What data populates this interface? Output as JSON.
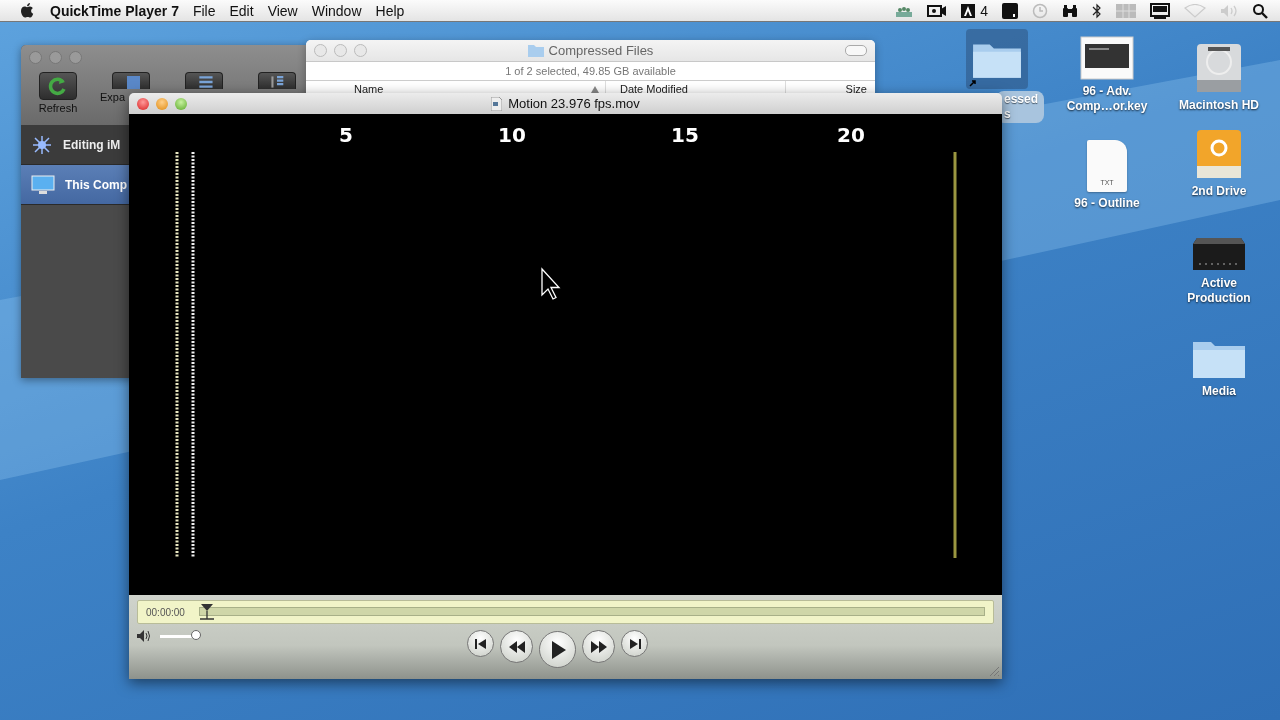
{
  "menubar": {
    "app_name": "QuickTime Player 7",
    "menus": [
      "File",
      "Edit",
      "View",
      "Window",
      "Help"
    ],
    "adobe_updates": "4"
  },
  "back_window": {
    "toolbar": [
      {
        "kind": "refresh",
        "label": "Refresh"
      },
      {
        "kind": "expand",
        "label": "Expa"
      },
      {
        "kind": "list"
      },
      {
        "kind": "detail"
      }
    ],
    "sidebar": [
      {
        "kind": "cluster",
        "label": "Editing iM",
        "selected": false
      },
      {
        "kind": "computer",
        "label": "This Comp",
        "selected": true
      }
    ]
  },
  "finder_window": {
    "title": "Compressed Files",
    "status": "1 of 2 selected, 49.85 GB available",
    "columns": [
      "Name",
      "Date Modified",
      "Size"
    ]
  },
  "hidden_desktop_icon": {
    "kind": "folder",
    "label_lines": [
      "essed",
      "s"
    ]
  },
  "player": {
    "title": "Motion 23.976 fps.mov",
    "frame_numbers": [
      "5",
      "10",
      "15",
      "20"
    ],
    "timecode": "00:00:00",
    "scrubber": {
      "level": 0
    },
    "volume": {
      "level": 1
    }
  },
  "desktop_icons": [
    {
      "kind": "keynote",
      "label": "96 - Adv. Comp…or.key"
    },
    {
      "kind": "text",
      "label": "96 - Outline",
      "badge": "TXT"
    },
    {
      "kind": "hard-drive",
      "label": "Macintosh HD"
    },
    {
      "kind": "firewire",
      "label": "2nd Drive"
    },
    {
      "kind": "external-drive",
      "label": "Active Production"
    },
    {
      "kind": "folder",
      "label": "Media"
    }
  ]
}
